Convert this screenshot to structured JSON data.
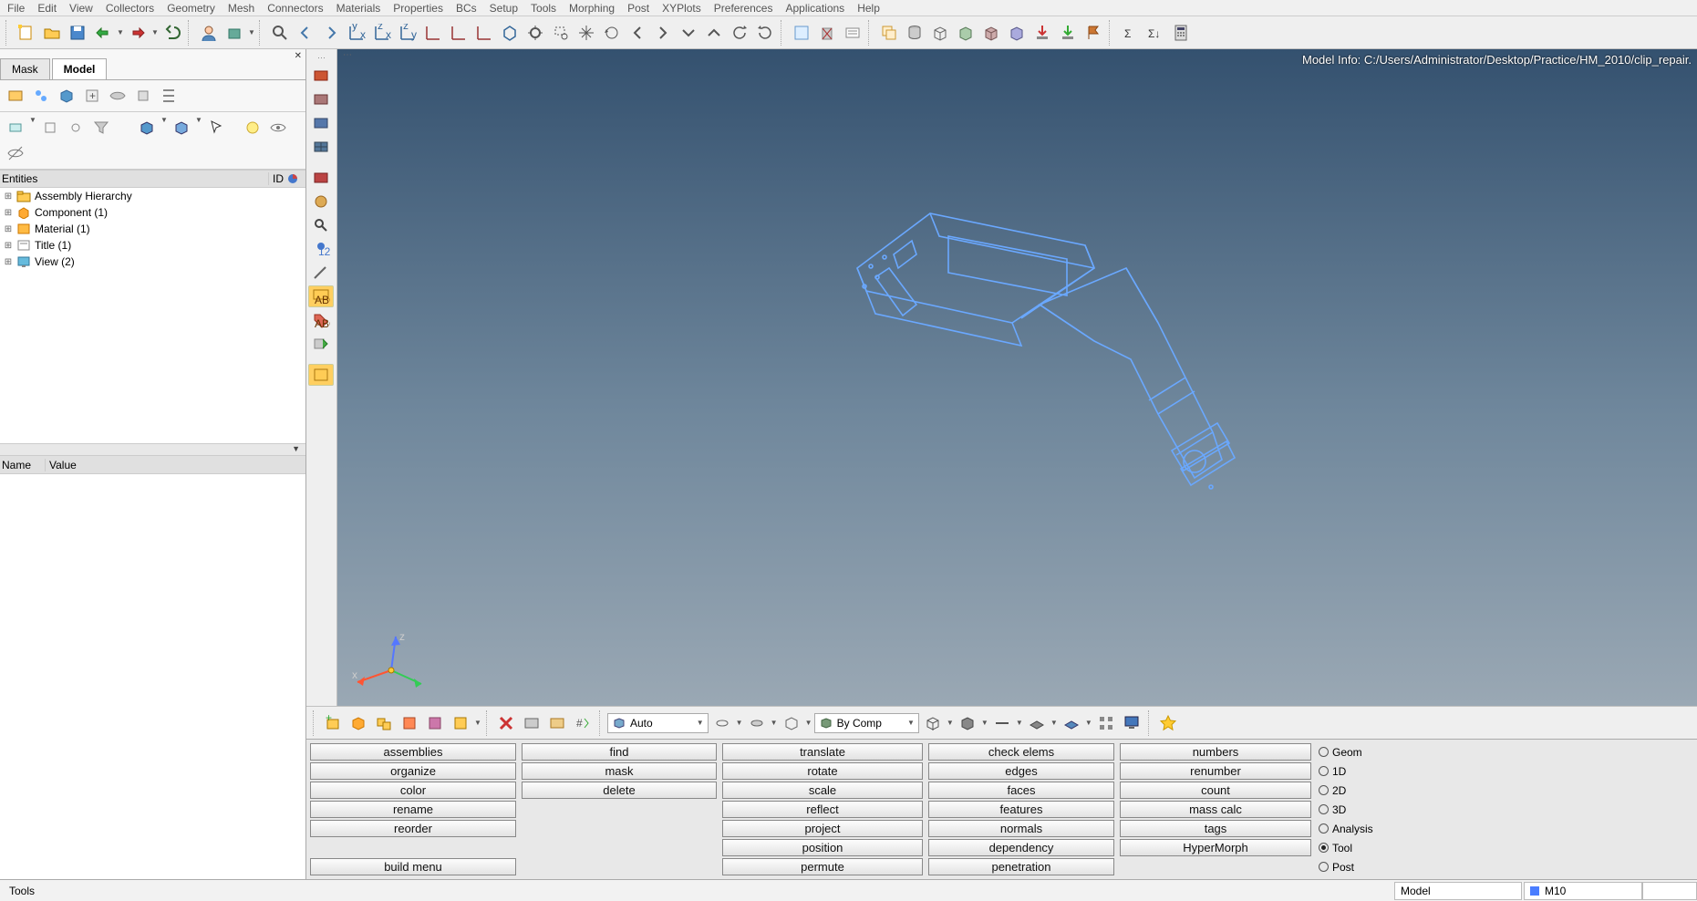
{
  "menus": [
    "File",
    "Edit",
    "View",
    "Collectors",
    "Geometry",
    "Mesh",
    "Connectors",
    "Materials",
    "Properties",
    "BCs",
    "Setup",
    "Tools",
    "Morphing",
    "Post",
    "XYPlots",
    "Preferences",
    "Applications",
    "Help"
  ],
  "left_tabs": {
    "mask": "Mask",
    "model": "Model"
  },
  "entities_header": {
    "col1": "Entities",
    "col2": "ID"
  },
  "tree": [
    {
      "label": "Assembly Hierarchy",
      "icon": "assembly"
    },
    {
      "label": "Component (1)",
      "icon": "component"
    },
    {
      "label": "Material (1)",
      "icon": "material"
    },
    {
      "label": "Title (1)",
      "icon": "title"
    },
    {
      "label": "View (2)",
      "icon": "view"
    }
  ],
  "name_value_header": {
    "name": "Name",
    "value": "Value"
  },
  "viewport": {
    "model_info": "Model Info: C:/Users/Administrator/Desktop/Practice/HM_2010/clip_repair.",
    "triad": {
      "x": "x",
      "z": "z"
    }
  },
  "display_toolbar": {
    "auto_label": "Auto",
    "bycomp_label": "By Comp"
  },
  "panel": {
    "col1": [
      "assemblies",
      "organize",
      "color",
      "rename",
      "reorder",
      "",
      "build menu"
    ],
    "col2": [
      "find",
      "mask",
      "delete",
      "",
      "",
      "",
      ""
    ],
    "col3": [
      "translate",
      "rotate",
      "scale",
      "reflect",
      "project",
      "position",
      "permute"
    ],
    "col4": [
      "check elems",
      "edges",
      "faces",
      "features",
      "normals",
      "dependency",
      "penetration"
    ],
    "col5": [
      "numbers",
      "renumber",
      "count",
      "mass calc",
      "tags",
      "HyperMorph",
      ""
    ],
    "pages": [
      "Geom",
      "1D",
      "2D",
      "3D",
      "Analysis",
      "Tool",
      "Post"
    ],
    "selected_page": "Tool"
  },
  "status": {
    "left": "Tools",
    "model": "Model",
    "m10": "M10"
  }
}
